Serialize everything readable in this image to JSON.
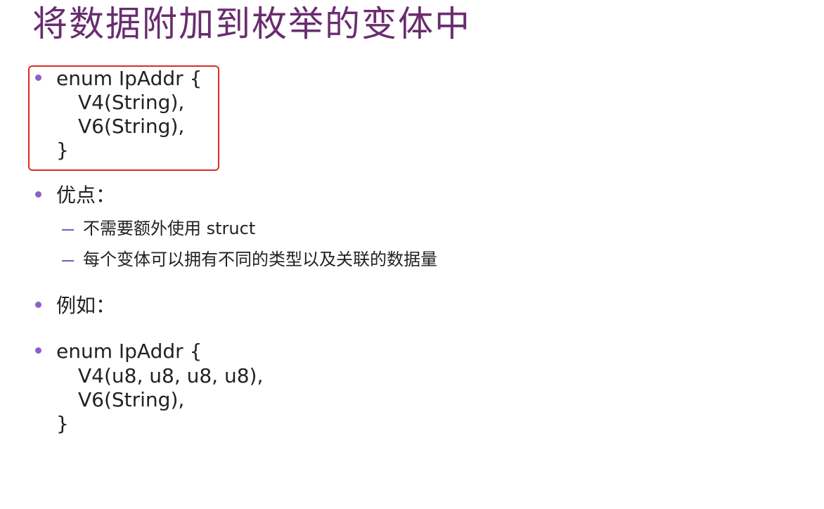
{
  "title": "将数据附加到枚举的变体中",
  "colors": {
    "title": "#6a2c6f",
    "bullet": "#8e5fc4",
    "dash": "#7a57c0",
    "highlight_border": "#e02b20"
  },
  "block1": {
    "lines": [
      "enum IpAddr {",
      "V4(String),",
      "V6(String),",
      "}"
    ]
  },
  "advantages": {
    "label": "优点：",
    "items": [
      "不需要额外使用 struct",
      "每个变体可以拥有不同的类型以及关联的数据量"
    ]
  },
  "example": {
    "label": "例如："
  },
  "block2": {
    "lines": [
      "enum IpAddr {",
      "V4(u8, u8, u8, u8),",
      "V6(String),",
      "}"
    ]
  }
}
